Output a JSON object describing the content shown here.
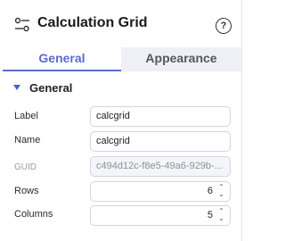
{
  "header": {
    "title": "Calculation Grid",
    "help_glyph": "?"
  },
  "tabs": [
    {
      "label": "General",
      "active": true
    },
    {
      "label": "Appearance",
      "active": false
    }
  ],
  "section": {
    "title": "General",
    "expanded": true
  },
  "fields": {
    "label": {
      "label": "Label",
      "value": "calcgrid"
    },
    "name": {
      "label": "Name",
      "value": "calcgrid"
    },
    "guid": {
      "label": "GUID",
      "value": "c494d12c-f8e5-49a6-929b-..."
    },
    "rows": {
      "label": "Rows",
      "value": "6"
    },
    "columns": {
      "label": "Columns",
      "value": "5"
    }
  },
  "colors": {
    "accent": "#5b6ad0",
    "tab_inactive_bg": "#eef0f5"
  }
}
